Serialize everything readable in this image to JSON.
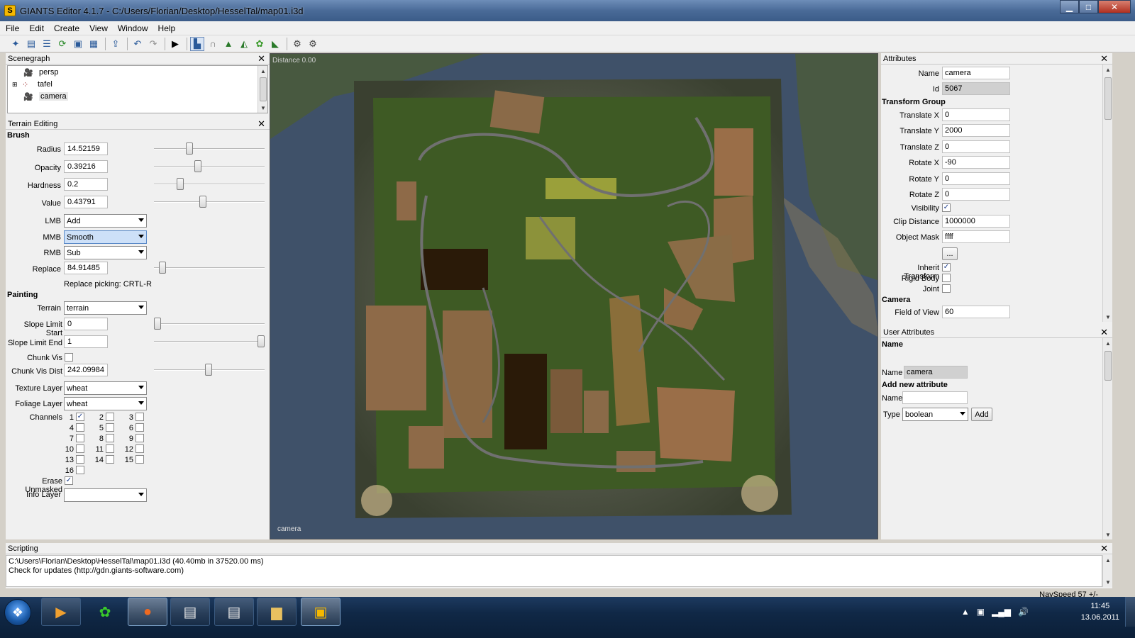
{
  "window": {
    "title": "GIANTS Editor 4.1.7 - C:/Users/Florian/Desktop/HesselTal/map01.i3d",
    "app_icon": "S"
  },
  "menu": [
    "File",
    "Edit",
    "Create",
    "View",
    "Window",
    "Help"
  ],
  "toolbar": {
    "icons": [
      "new-scene-icon",
      "open-icon",
      "list-icon",
      "refresh-icon",
      "save-icon",
      "save-all-icon",
      "import-icon",
      "undo-icon",
      "redo-icon",
      "play-icon",
      "select-tool-icon",
      "move-tool-icon",
      "terrain-sculpt-icon",
      "terrain-paint-icon",
      "foliage-paint-icon",
      "terrain-lower-icon",
      "settings-icon",
      "settings-alt-icon"
    ]
  },
  "scenegraph": {
    "title": "Scenegraph",
    "items": [
      {
        "label": "persp",
        "icon": "camera-icon"
      },
      {
        "label": "tafel",
        "icon": "group-icon"
      },
      {
        "label": "camera",
        "icon": "camera-icon",
        "selected": true
      }
    ]
  },
  "terrain": {
    "title": "Terrain Editing",
    "brush_section": "Brush",
    "radius_label": "Radius",
    "radius": "14.52159",
    "radius_level": 0.31,
    "opacity_label": "Opacity",
    "opacity": "0.39216",
    "opacity_level": 0.39,
    "hardness_label": "Hardness",
    "hardness": "0.2",
    "hardness_level": 0.22,
    "value_label": "Value",
    "value": "0.43791",
    "value_level": 0.44,
    "lmb_label": "LMB",
    "lmb": "Add",
    "mmb_label": "MMB",
    "mmb": "Smooth",
    "rmb_label": "RMB",
    "rmb": "Sub",
    "replace_label": "Replace",
    "replace": "84.91485",
    "replace_level": 0.05,
    "replace_picking": "Replace picking: CRTL-R",
    "painting_section": "Painting",
    "terrain_label": "Terrain",
    "terrain_value": "terrain",
    "slope_start_label": "Slope Limit Start",
    "slope_start": "0",
    "slope_start_level": 0.0,
    "slope_end_label": "Slope Limit End",
    "slope_end": "1",
    "slope_end_level": 1.0,
    "chunk_vis_label": "Chunk Vis",
    "chunk_vis_dist_label": "Chunk Vis Dist",
    "chunk_vis_dist": "242.09984",
    "chunk_vis_dist_level": 0.49,
    "texture_layer_label": "Texture Layer",
    "texture_layer": "wheat",
    "foliage_layer_label": "Foliage Layer",
    "foliage_layer": "wheat",
    "channels_label": "Channels",
    "channels": [
      {
        "n": "1",
        "checked": true
      },
      {
        "n": "2"
      },
      {
        "n": "3"
      },
      {
        "n": "4"
      },
      {
        "n": "5"
      },
      {
        "n": "6"
      },
      {
        "n": "7"
      },
      {
        "n": "8"
      },
      {
        "n": "9"
      },
      {
        "n": "10"
      },
      {
        "n": "11"
      },
      {
        "n": "12"
      },
      {
        "n": "13"
      },
      {
        "n": "14"
      },
      {
        "n": "15"
      },
      {
        "n": "16"
      }
    ],
    "erase_unmasked_label": "Erase Unmasked",
    "info_layer_label": "Info Layer",
    "info_layer": ""
  },
  "viewport": {
    "distance": "Distance 0.00",
    "camera": "camera"
  },
  "attributes": {
    "title": "Attributes",
    "name_label": "Name",
    "name": "camera",
    "id_label": "Id",
    "id": "5067",
    "transform_section": "Transform Group",
    "tx_label": "Translate X",
    "tx": "0",
    "ty_label": "Translate Y",
    "ty": "2000",
    "tz_label": "Translate Z",
    "tz": "0",
    "rx_label": "Rotate X",
    "rx": "-90",
    "ry_label": "Rotate Y",
    "ry": "0",
    "rz_label": "Rotate Z",
    "rz": "0",
    "visibility_label": "Visibility",
    "clip_label": "Clip Distance",
    "clip": "1000000",
    "mask_label": "Object Mask",
    "mask": "ffff",
    "more_button": "...",
    "inherit_label": "Inherit Transform",
    "rigid_label": "Rigid Body",
    "joint_label": "Joint",
    "camera_section": "Camera",
    "fov_label": "Field of View",
    "fov": "60"
  },
  "user_attributes": {
    "title": "User Attributes",
    "name_section": "Name",
    "name_label": "Name",
    "name": "camera",
    "add_section": "Add new attribute",
    "new_name_label": "Name",
    "new_name": "",
    "type_label": "Type",
    "type": "boolean",
    "add_button": "Add"
  },
  "scripting": {
    "title": "Scripting",
    "line1": "C:\\Users\\Florian\\Desktop\\HesselTal\\map01.i3d (40.40mb in 37520.00 ms)",
    "line2": "Check for updates (http://gdn.giants-software.com)"
  },
  "status": {
    "navspeed": "NavSpeed 57 +/-"
  },
  "taskbar": {
    "apps": [
      "media-player-icon",
      "icq-flower-icon",
      "firefox-icon",
      "document-icon",
      "document-2-icon",
      "explorer-folder-icon",
      "giants-editor-icon"
    ],
    "time": "11:45",
    "date": "13.06.2011"
  }
}
